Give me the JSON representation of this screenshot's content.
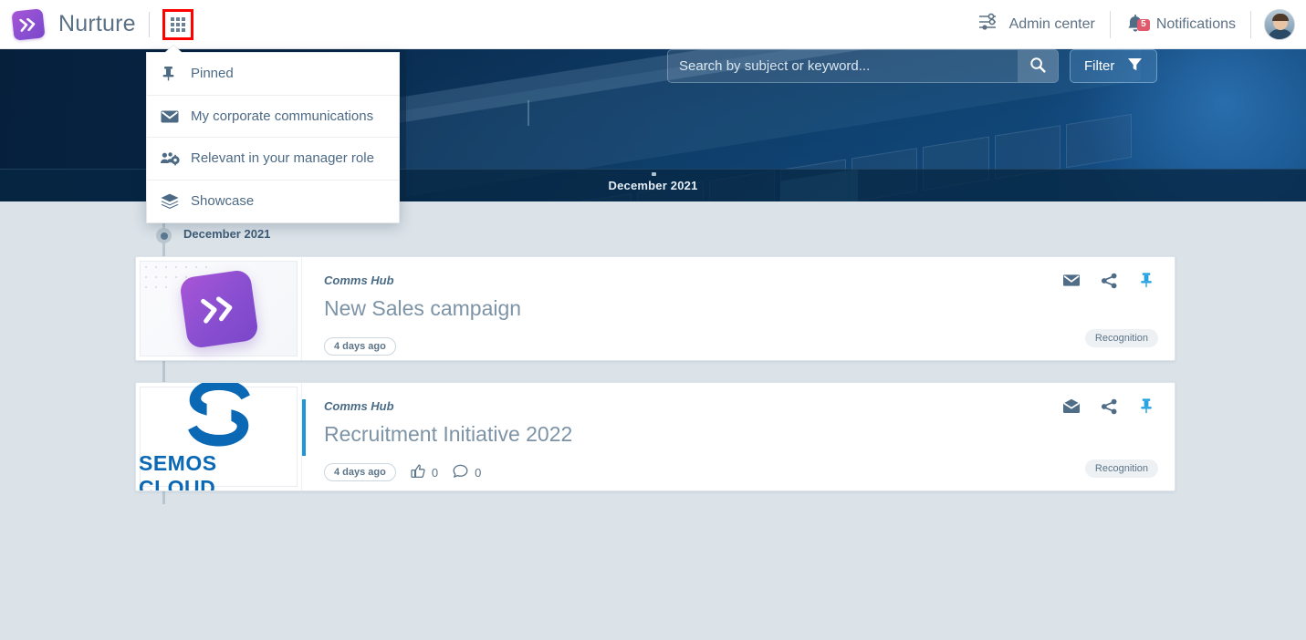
{
  "topbar": {
    "brand_name": "Nurture",
    "grid_icon": "apps-grid-icon",
    "admin_center_label": "Admin center",
    "admin_center_icon": "sliders-icon",
    "notifications_label": "Notifications",
    "notifications_icon": "bell-icon",
    "notifications_count": "5",
    "avatar_alt": "user-avatar"
  },
  "dropdown": {
    "items": [
      {
        "label": "Pinned",
        "icon": "pin-icon"
      },
      {
        "label": "My corporate communications",
        "icon": "envelope-icon"
      },
      {
        "label": "Relevant in your manager role",
        "icon": "people-gear-icon"
      },
      {
        "label": "Showcase",
        "icon": "layers-icon"
      }
    ]
  },
  "hero": {
    "month_band_label": "December 2021"
  },
  "search": {
    "placeholder": "Search by subject or keyword...",
    "value": "",
    "search_icon": "magnifier-icon",
    "filter_label": "Filter",
    "filter_icon": "funnel-icon"
  },
  "timeline": {
    "month_label": "December 2021"
  },
  "feed": {
    "cards": [
      {
        "hub": "Comms Hub",
        "title": "New Sales campaign",
        "time": "4 days ago",
        "tag": "Recognition",
        "thumb": "nurture-logo",
        "has_accent": false,
        "envelope_state": "closed",
        "stats": [],
        "actions": [
          "envelope-icon",
          "share-icon",
          "pin-icon"
        ]
      },
      {
        "hub": "Comms Hub",
        "title": "Recruitment Initiative 2022",
        "time": "4 days ago",
        "tag": "Recognition",
        "thumb": "semos-cloud-logo",
        "thumb_text": "SEMOS CLOUD",
        "has_accent": true,
        "envelope_state": "open",
        "stats": [
          {
            "icon": "thumbs-up-icon",
            "value": "0"
          },
          {
            "icon": "comment-icon",
            "value": "0"
          }
        ],
        "actions": [
          "envelope-open-icon",
          "share-icon",
          "pin-icon"
        ]
      }
    ]
  },
  "colors": {
    "brand_purple": "#8b4fd1",
    "accent_blue": "#2196d6",
    "pin_blue": "#27a3e0",
    "badge_red": "#e05a6b",
    "page_bg": "#dbe3e9",
    "text_muted": "#5c7184",
    "highlight_red": "#ff0000"
  }
}
